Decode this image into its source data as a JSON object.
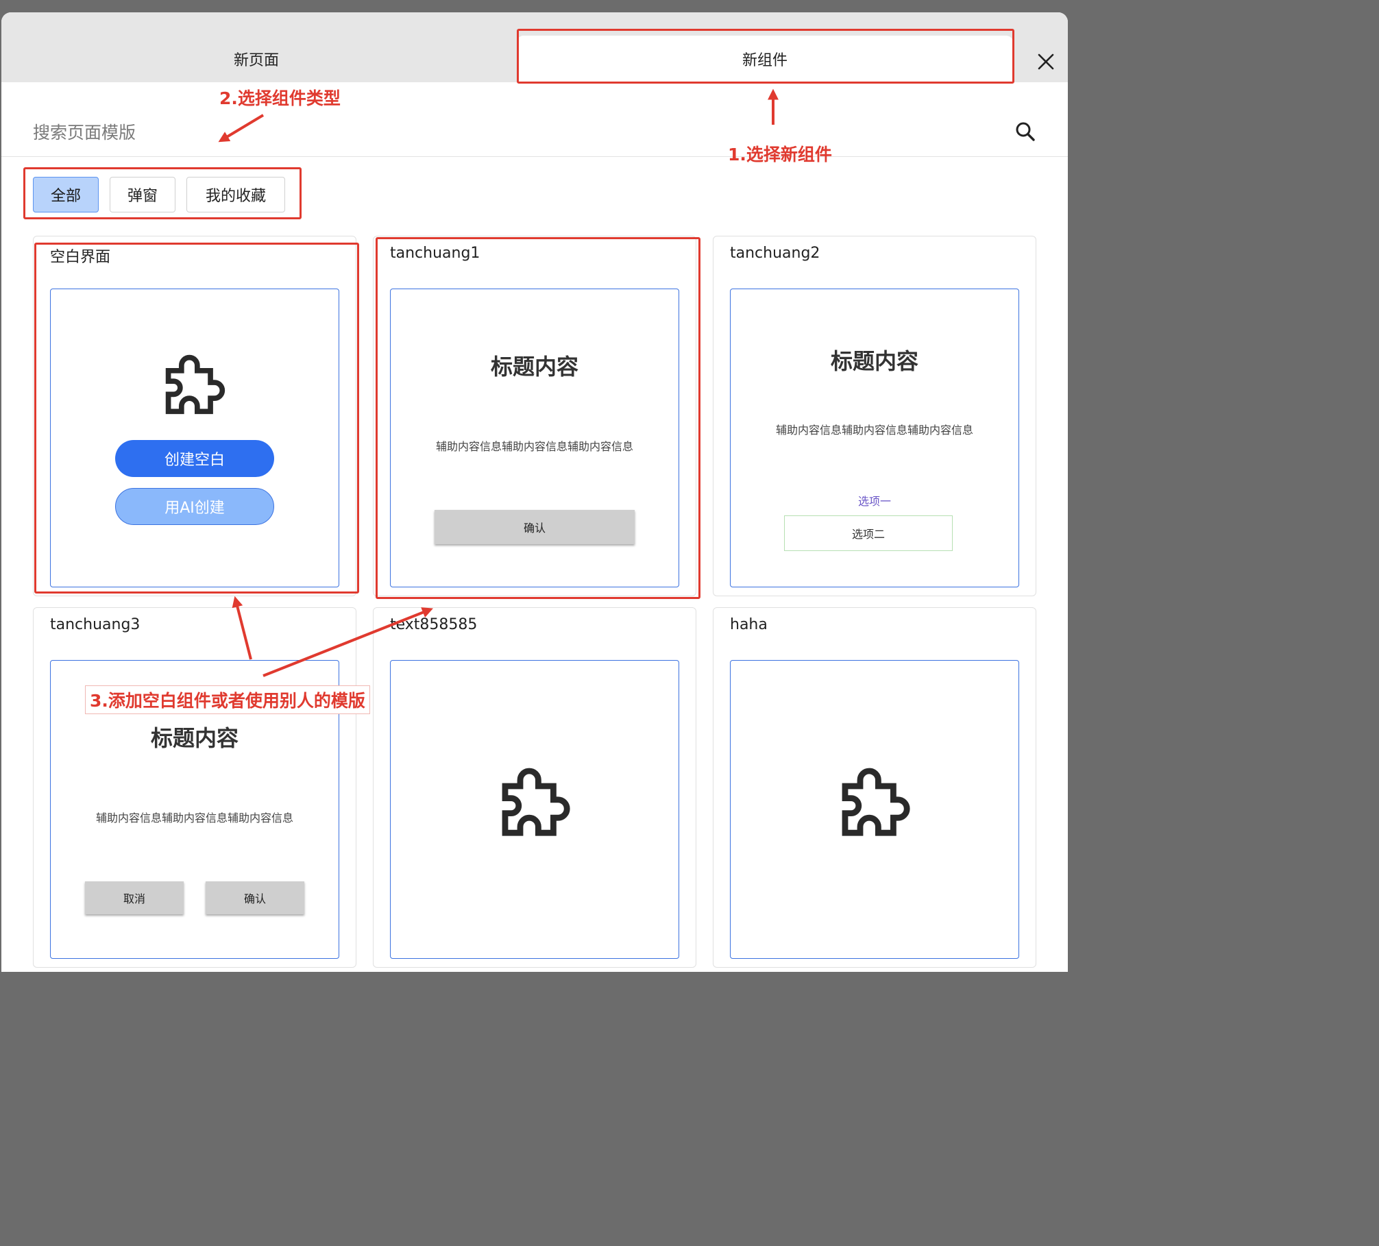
{
  "tabs": {
    "new_page": "新页面",
    "new_component": "新组件"
  },
  "search": {
    "placeholder": "搜索页面模版"
  },
  "filters": [
    {
      "label": "全部",
      "active": true
    },
    {
      "label": "弹窗",
      "active": false
    },
    {
      "label": "我的收藏",
      "active": false
    }
  ],
  "cards": [
    {
      "title": "空白界面",
      "create_blank_label": "创建空白",
      "create_ai_label": "用AI创建"
    },
    {
      "title": "tanchuang1",
      "preview_title": "标题内容",
      "preview_subtitle": "辅助内容信息辅助内容信息辅助内容信息",
      "confirm_label": "确认"
    },
    {
      "title": "tanchuang2",
      "preview_title": "标题内容",
      "preview_subtitle": "辅助内容信息辅助内容信息辅助内容信息",
      "option_one": "选项一",
      "option_two": "选项二"
    },
    {
      "title": "tanchuang3",
      "preview_title": "标题内容",
      "preview_subtitle": "辅助内容信息辅助内容信息辅助内容信息",
      "cancel_label": "取消",
      "confirm_label": "确认"
    },
    {
      "title": "text858585"
    },
    {
      "title": "haha"
    }
  ],
  "annotations": {
    "step1": "1.选择新组件",
    "step2": "2.选择组件类型",
    "step3": "3.添加空白组件或者使用别人的模版"
  },
  "icons": {
    "close": "close-icon",
    "search": "search-icon",
    "template": "puzzle-icon"
  },
  "colors": {
    "accent": "#2e6ff0",
    "accent_light": "#8ab8fb",
    "filter_active": "#b8d3fb",
    "annotation": "#e03a2f",
    "preview_border": "#3b72e0"
  }
}
